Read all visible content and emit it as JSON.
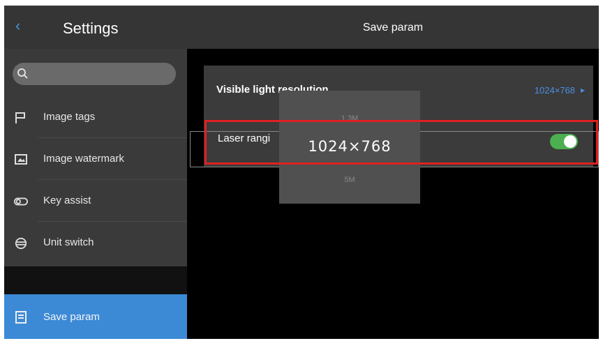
{
  "sidebar": {
    "title": "Settings",
    "items": [
      {
        "label": "Image tags",
        "icon": "flag-icon"
      },
      {
        "label": "Image watermark",
        "icon": "watermark-icon"
      },
      {
        "label": "Key assist",
        "icon": "toggle-icon"
      },
      {
        "label": "Unit switch",
        "icon": "unit-switch-icon"
      }
    ],
    "active_item": {
      "label": "Save param",
      "icon": "save-icon"
    }
  },
  "header": {
    "title": "Save param"
  },
  "settings": {
    "visible_light": {
      "label": "Visible light resolution",
      "value": "1024×768"
    },
    "laser_ranging": {
      "label": "Laser rangi",
      "enabled": true
    }
  },
  "picker": {
    "options": [
      "1.3M",
      "1024×768",
      "5M"
    ],
    "selected": "1024×768"
  },
  "colors": {
    "accent": "#3c8ad6",
    "toggle_on": "#4caf50",
    "highlight": "#e02020"
  }
}
